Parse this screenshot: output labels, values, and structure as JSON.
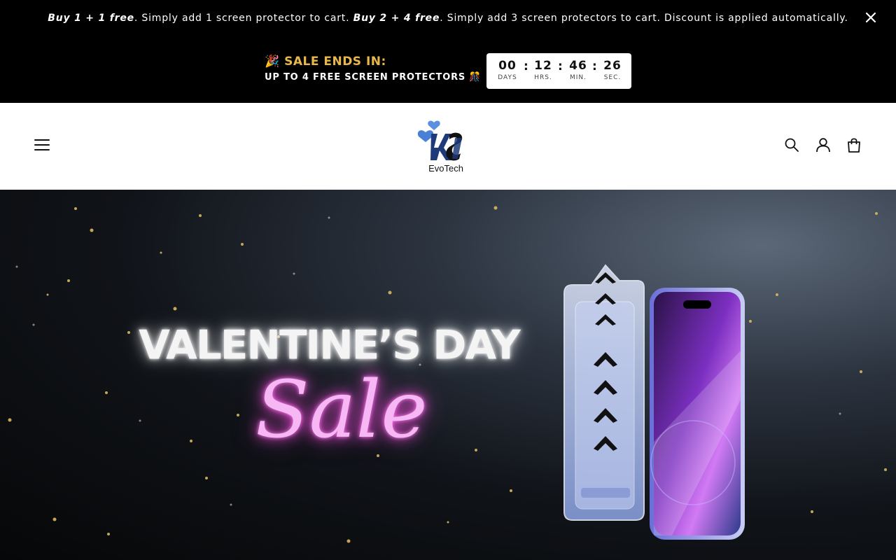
{
  "announcement": {
    "bold1": "Buy 1 + 1 free",
    "text1": ". Simply add 1 screen protector to cart. ",
    "bold2": "Buy 2 + 4 free",
    "text2": ". Simply add 3 screen protectors to cart. Discount is applied automatically.",
    "close_icon": "close-icon"
  },
  "countdown": {
    "emoji_left": "🎉",
    "title": "SALE ENDS IN:",
    "subtitle": "UP TO 4 FREE SCREEN PROTECTORS",
    "emoji_right": "🎊",
    "days": "00",
    "days_label": "DAYS",
    "hours": "12",
    "hours_label": "HRS.",
    "minutes": "46",
    "minutes_label": "MIN.",
    "seconds": "26",
    "seconds_label": "SEC.",
    "separator": ":"
  },
  "header": {
    "menu_icon": "hamburger-menu-icon",
    "logo_text": "EvoTech",
    "icons": [
      "search-icon",
      "account-icon",
      "cart-icon"
    ]
  },
  "hero": {
    "title": "VALENTINE’S DAY",
    "script": "Sale"
  },
  "colors": {
    "sale_title": "#e8b84a",
    "logo_heart": "#4a7fd6",
    "logo_mark": "#1f3a7a",
    "neon_pink": "#f7b6f4"
  }
}
